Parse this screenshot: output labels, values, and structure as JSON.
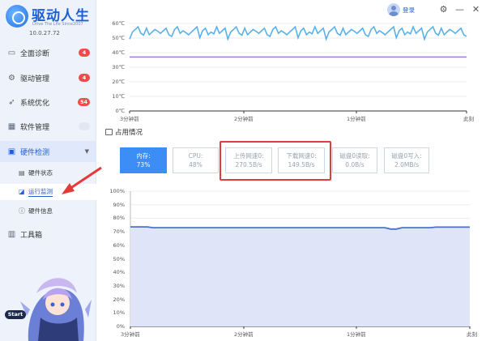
{
  "app": {
    "title": "驱动人生",
    "subtitle": "Drive The Life  Since2007",
    "version": "10.0.27.72"
  },
  "sidebar": {
    "items": [
      {
        "label": "全面诊断",
        "badge": "4",
        "icon": "monitor-icon"
      },
      {
        "label": "驱动管理",
        "badge": "4",
        "icon": "gear-icon"
      },
      {
        "label": "系统优化",
        "badge": "54",
        "icon": "rocket-icon"
      },
      {
        "label": "软件管理",
        "icon": "grid-icon"
      },
      {
        "label": "硬件检测",
        "icon": "chip-icon"
      },
      {
        "label": "工具箱",
        "icon": "toolbox-icon"
      }
    ],
    "sub_items": [
      {
        "label": "硬件状态",
        "icon": "doc-icon"
      },
      {
        "label": "运行监测",
        "icon": "chart-icon"
      },
      {
        "label": "硬件信息",
        "icon": "info-icon"
      }
    ],
    "start_label": "Start"
  },
  "header": {
    "login_label": "登录"
  },
  "top_chart": {
    "y_ticks": [
      "60℃",
      "50℃",
      "40℃",
      "30℃",
      "20℃",
      "10℃",
      "0℃"
    ],
    "x_ticks": [
      "3分钟前",
      "2分钟前",
      "1分钟前",
      "此刻"
    ]
  },
  "section": {
    "title": "占用情况"
  },
  "metrics": [
    {
      "label": "内存:",
      "value": "73%"
    },
    {
      "label": "CPU:",
      "value": "48%"
    },
    {
      "label": "上传网速0:",
      "value": "270.5B/s"
    },
    {
      "label": "下载网速0:",
      "value": "149.5B/s"
    },
    {
      "label": "磁盘0读取:",
      "value": "0.0B/s"
    },
    {
      "label": "磁盘0写入:",
      "value": "2.0MB/s"
    }
  ],
  "bottom_chart": {
    "y_ticks": [
      "100%",
      "90%",
      "80%",
      "70%",
      "60%",
      "50%",
      "40%",
      "30%",
      "20%",
      "10%",
      "0%"
    ],
    "x_ticks": [
      "3分钟前",
      "2分钟前",
      "1分钟前",
      "此刻"
    ]
  },
  "colors": {
    "accent": "#3c8df5",
    "temp_line_1": "#5ab0e8",
    "temp_line_2": "#a77bd8",
    "memory_line": "#4d6fcf",
    "highlight": "#e33b3b"
  },
  "chart_data": [
    {
      "type": "line",
      "x": [
        "3分钟前",
        "2分钟前",
        "1分钟前",
        "此刻"
      ],
      "ylim": [
        0,
        60
      ],
      "series": [
        {
          "values": [
            55,
            56,
            55,
            56
          ]
        },
        {
          "values": [
            37,
            37,
            37,
            37
          ]
        }
      ]
    },
    {
      "type": "area",
      "x": [
        "3分钟前",
        "2分钟前",
        "1分钟前",
        "此刻"
      ],
      "ylim": [
        0,
        100
      ],
      "series": [
        {
          "values": [
            73,
            73,
            73,
            73
          ]
        }
      ]
    }
  ]
}
